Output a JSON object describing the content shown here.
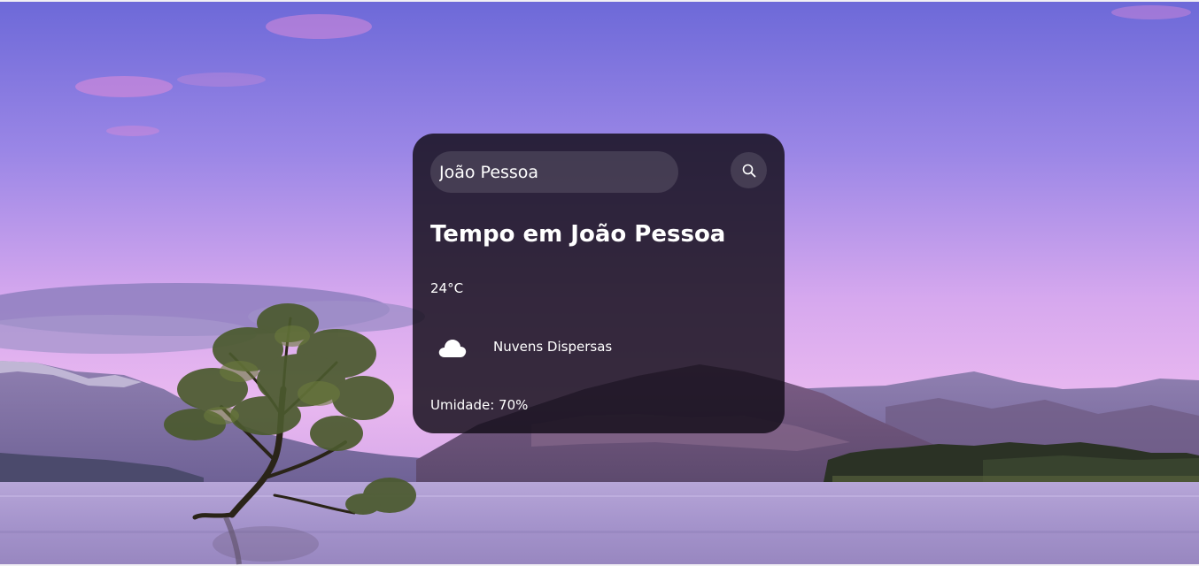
{
  "search": {
    "value": "João Pessoa",
    "icon": "search-icon"
  },
  "weather": {
    "title": "Tempo em João Pessoa",
    "temperature": "24°C",
    "condition_icon": "cloud-icon",
    "description": "Nuvens Dispersas",
    "humidity": "Umidade: 70%"
  },
  "colors": {
    "card_background": "#140e1a",
    "text": "#ffffff",
    "sky_top": "#6c6ad6",
    "sky_bottom": "#e4b2ee"
  }
}
